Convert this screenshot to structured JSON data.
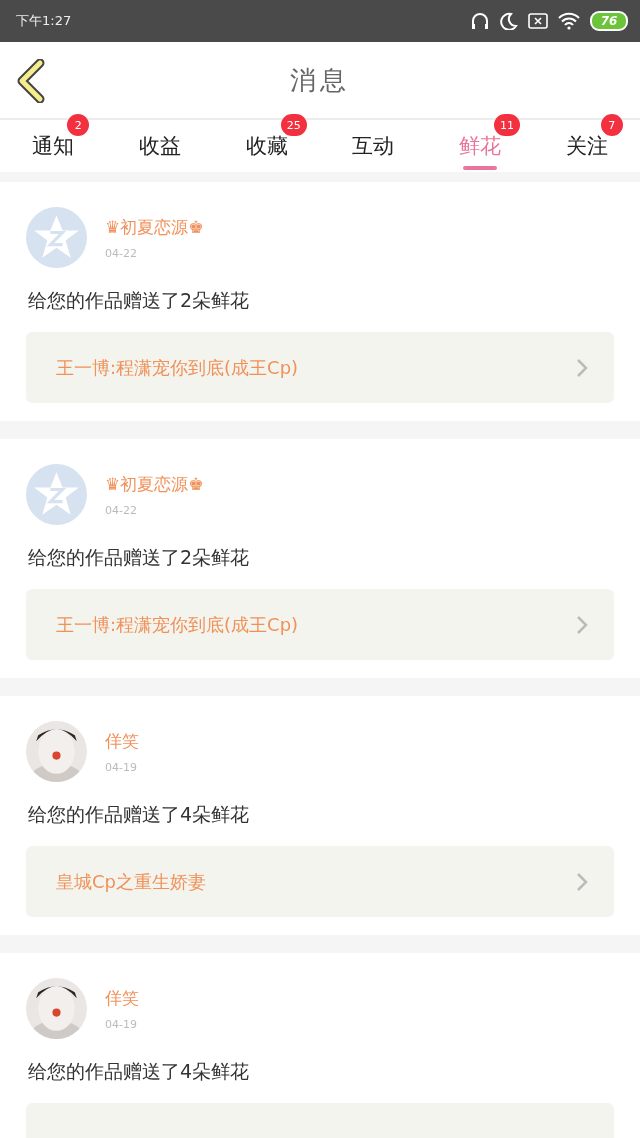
{
  "status_bar": {
    "time": "下午1:27",
    "battery": "76"
  },
  "header": {
    "title": "消息"
  },
  "tabs": [
    {
      "label": "通知",
      "badge": "2",
      "selected": false
    },
    {
      "label": "收益",
      "selected": false
    },
    {
      "label": "收藏",
      "badge": "25",
      "selected": false
    },
    {
      "label": "互动",
      "selected": false
    },
    {
      "label": "鲜花",
      "badge": "11",
      "selected": true
    },
    {
      "label": "关注",
      "badge": "7",
      "selected": false
    }
  ],
  "messages": [
    {
      "avatar": {
        "kind": "default"
      },
      "name": "♛初夏恋源♚",
      "date": "04-22",
      "text": "给您的作品赠送了2朵鲜花",
      "work_title": "王一博:程潇宠你到底(成王Cp)"
    },
    {
      "avatar": {
        "kind": "default"
      },
      "name": "♛初夏恋源♚",
      "date": "04-22",
      "text": "给您的作品赠送了2朵鲜花",
      "work_title": "王一博:程潇宠你到底(成王Cp)"
    },
    {
      "name": "佯笑",
      "date": "04-19",
      "text": "给您的作品赠送了4朵鲜花",
      "work_title": "皇城Cp之重生娇妻"
    },
    {
      "name": "佯笑",
      "date": "04-19",
      "text": "给您的作品赠送了4朵鲜花"
    }
  ]
}
